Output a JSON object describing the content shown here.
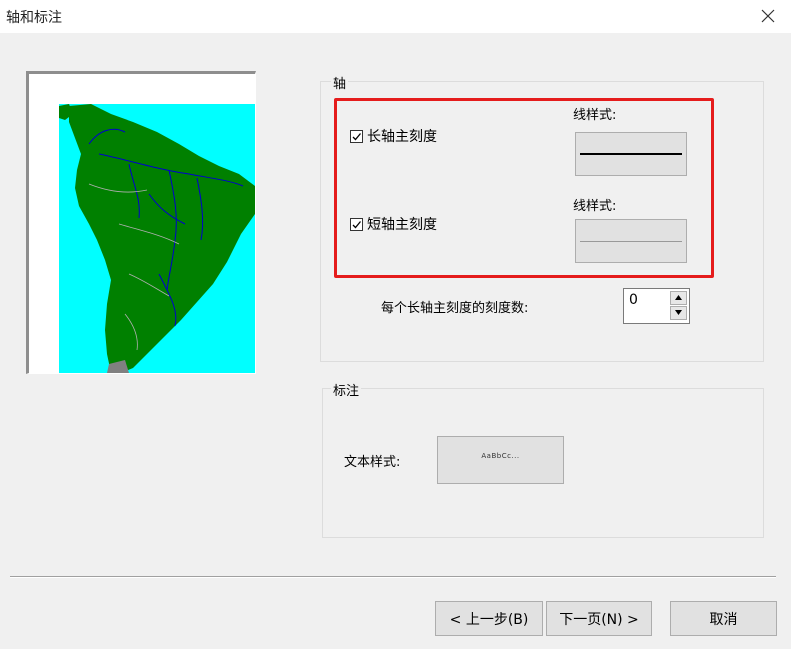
{
  "window": {
    "title": "轴和标注"
  },
  "axis_group": {
    "title": "轴",
    "major_ticks": {
      "label": "长轴主刻度",
      "checked": true,
      "style_label": "线样式:"
    },
    "minor_ticks": {
      "label": "短轴主刻度",
      "checked": true,
      "style_label": "线样式:"
    },
    "ticks_per_major_label": "每个长轴主刻度的刻度数:",
    "ticks_per_major_value": "0"
  },
  "label_group": {
    "title": "标注",
    "text_style_label": "文本样式:",
    "text_style_preview": "AaBbCc..."
  },
  "buttons": {
    "back": "< 上一步(B)",
    "next": "下一页(N) >",
    "cancel": "取消"
  },
  "colors": {
    "sea": "#00ffff",
    "land": "#008000",
    "rivers": "#0000cc",
    "highlight": "#e51c1c"
  }
}
